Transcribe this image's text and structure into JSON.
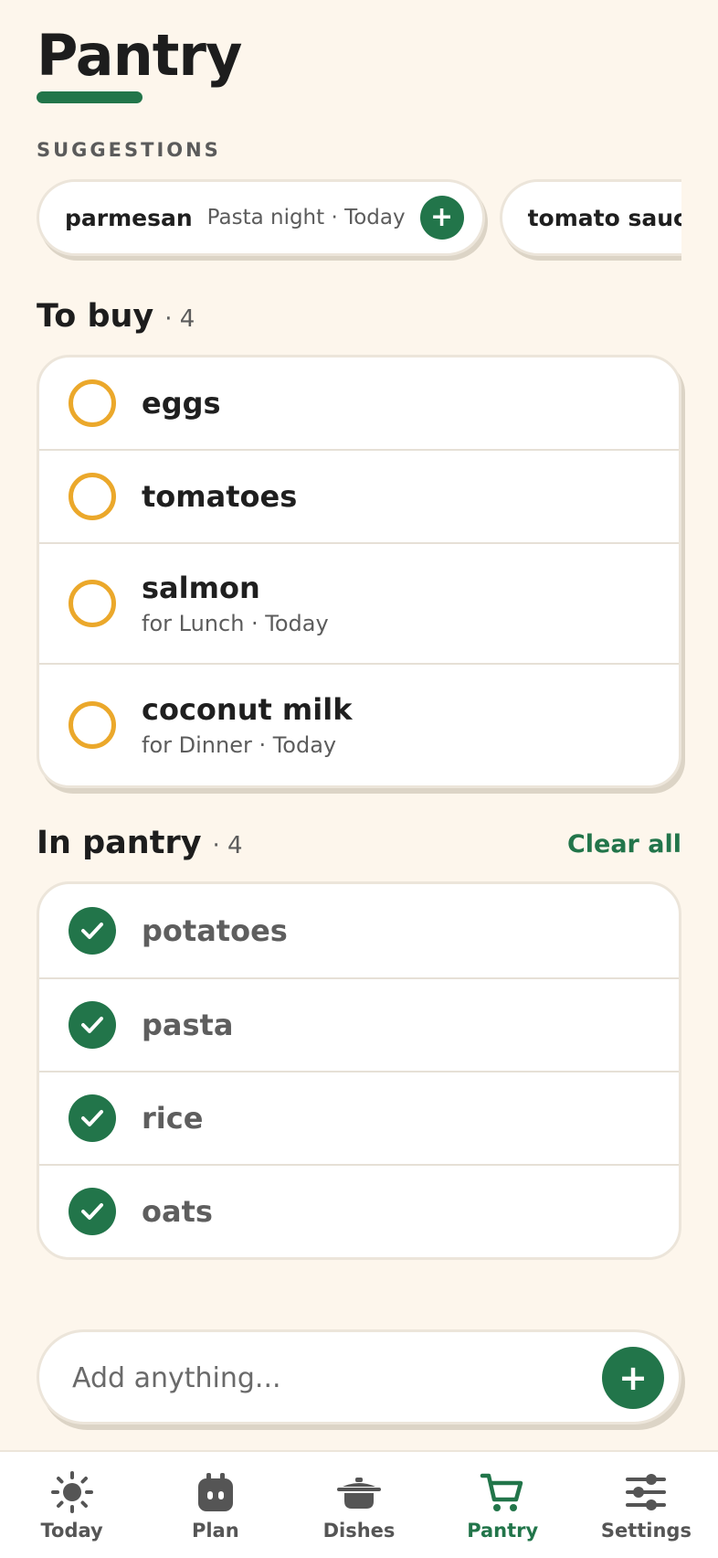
{
  "header": {
    "title": "Pantry"
  },
  "suggestions": {
    "label": "SUGGESTIONS",
    "items": [
      {
        "name": "parmesan",
        "meta": "Pasta night · Today",
        "add_label": "+"
      },
      {
        "name": "tomato sauce"
      }
    ]
  },
  "to_buy": {
    "title": "To buy",
    "count": "· 4",
    "items": [
      {
        "name": "eggs"
      },
      {
        "name": "tomatoes"
      },
      {
        "name": "salmon",
        "sub": "for Lunch · Today"
      },
      {
        "name": "coconut milk",
        "sub": "for Dinner · Today"
      }
    ]
  },
  "in_pantry": {
    "title": "In pantry",
    "count": "· 4",
    "clear_label": "Clear all",
    "items": [
      {
        "name": "potatoes"
      },
      {
        "name": "pasta"
      },
      {
        "name": "rice"
      },
      {
        "name": "oats"
      }
    ]
  },
  "add_bar": {
    "placeholder": "Add anything...",
    "add_label": "+"
  },
  "tabs": [
    {
      "label": "Today",
      "icon": "sun-icon",
      "active": false
    },
    {
      "label": "Plan",
      "icon": "calendar-face-icon",
      "active": false
    },
    {
      "label": "Dishes",
      "icon": "pot-icon",
      "active": false
    },
    {
      "label": "Pantry",
      "icon": "cart-icon",
      "active": true
    },
    {
      "label": "Settings",
      "icon": "sliders-icon",
      "active": false
    }
  ],
  "colors": {
    "accent": "#22754a",
    "pending": "#eba82b",
    "background": "#fdf6ec"
  }
}
